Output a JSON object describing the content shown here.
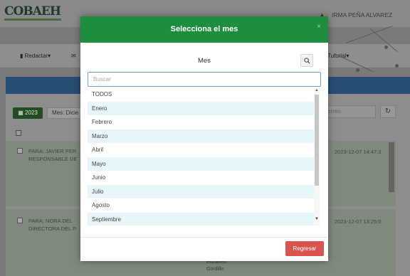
{
  "header": {
    "logo_text": "COBAEH",
    "user_name": "IRMA PEÑA ALVAREZ"
  },
  "nav": {
    "redactar": "Redactar",
    "tutorial": "Tutorial"
  },
  "filters": {
    "year": "2023",
    "mes_prefix": "Mes: Dicie",
    "search_placeholder": "orreo"
  },
  "rows": [
    {
      "text_line1": "PARA: JAVIER PER",
      "text_line2": "RESPONSABLE DE",
      "date": "2023-12-07 14:47:3"
    },
    {
      "text_line1": "PARA: NORA DEL",
      "text_line2": "DIRECTORA DEL P",
      "date": "2023-12-07 13:25:0"
    }
  ],
  "footer_bg": {
    "line1": "Elizabeth",
    "line2": "Gordillo"
  },
  "modal": {
    "title": "Selecciona el mes",
    "close": "×",
    "field_label": "Mes",
    "search_placeholder": "Buscar",
    "options": [
      "TODOS",
      "Enero",
      "Febrero",
      "Marzo",
      "Abril",
      "Mayo",
      "Junio",
      "Julio",
      "Agosto",
      "Septiembre"
    ],
    "back_button": "Regresar"
  },
  "colors": {
    "header_green": "#1e8e3e",
    "stripe": "#e6f6fa",
    "back_button": "#d9534f",
    "input_focus": "#6aa6dc"
  }
}
